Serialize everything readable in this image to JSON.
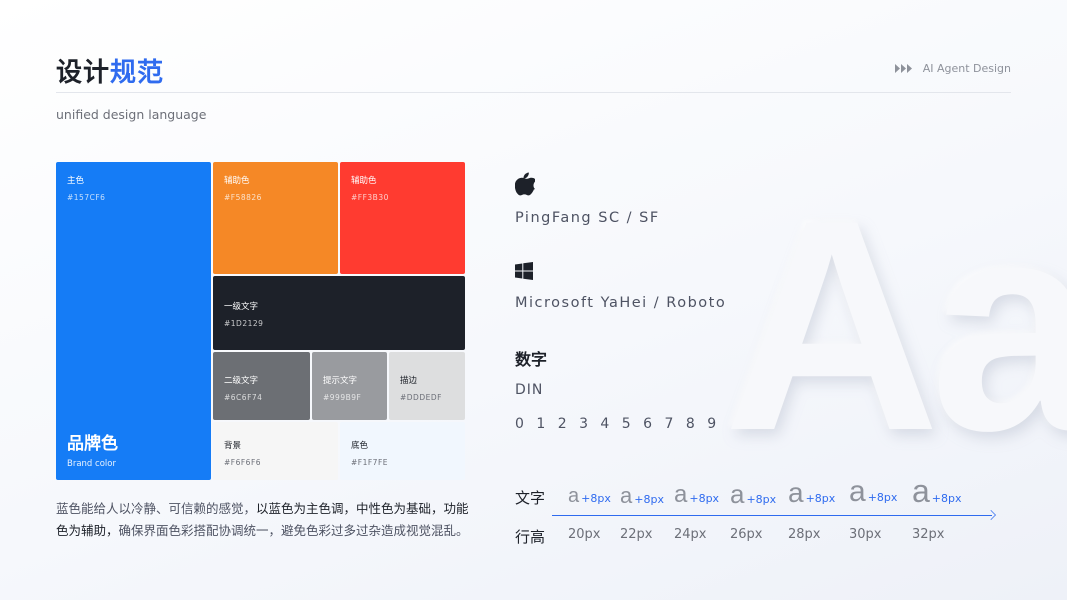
{
  "header": {
    "title_part1": "设计",
    "title_part2": "规范",
    "subtitle": "unified design language",
    "brand": "AI Agent Design"
  },
  "palette": {
    "primary": {
      "name": "主色",
      "hex": "#157CF6",
      "big": "品牌色",
      "big_en": "Brand color",
      "color": "#157CF6"
    },
    "aux1": {
      "name": "辅助色",
      "hex": "#F58826",
      "color": "#F58826"
    },
    "aux2": {
      "name": "辅助色",
      "hex": "#FF3B30",
      "color": "#FF3B30"
    },
    "text1": {
      "name": "一级文字",
      "hex": "#1D2129",
      "color": "#1D2129"
    },
    "text2": {
      "name": "二级文字",
      "hex": "#6C6F74",
      "color": "#6C6F74"
    },
    "hint": {
      "name": "提示文字",
      "hex": "#999B9F",
      "color": "#999B9F"
    },
    "border": {
      "name": "描边",
      "hex": "#DDDEDF",
      "color": "#DDDEDF"
    },
    "bg": {
      "name": "背景",
      "hex": "#F6F6F6",
      "color": "#F6F6F6"
    },
    "base": {
      "name": "底色",
      "hex": "#F1F7FE",
      "color": "#F1F7FE"
    }
  },
  "description": {
    "part1": "蓝色能给人以冷静、可信赖的感觉，",
    "part2": "以蓝色为主色调，中性色为基础，功能色为辅助，",
    "part3": "确保界面色彩搭配协调统一，避免色彩过多过杂造成视觉混乱。"
  },
  "fonts": {
    "apple_icon": "apple-icon",
    "apple_font": "PingFang SC / SF",
    "windows_icon": "windows-icon",
    "windows_font": "Microsoft YaHei / Roboto",
    "numbers_title": "数字",
    "numbers_font": "DIN",
    "digits": "0123456789",
    "bg_letters": "Aa"
  },
  "type_scale": {
    "text_label": "文字",
    "line_height_label": "行高",
    "glyph": "a",
    "step": "+8px",
    "sizes": [
      "20px",
      "22px",
      "24px",
      "26px",
      "28px",
      "30px",
      "32px"
    ]
  },
  "accent_color": "#2F6BEF"
}
